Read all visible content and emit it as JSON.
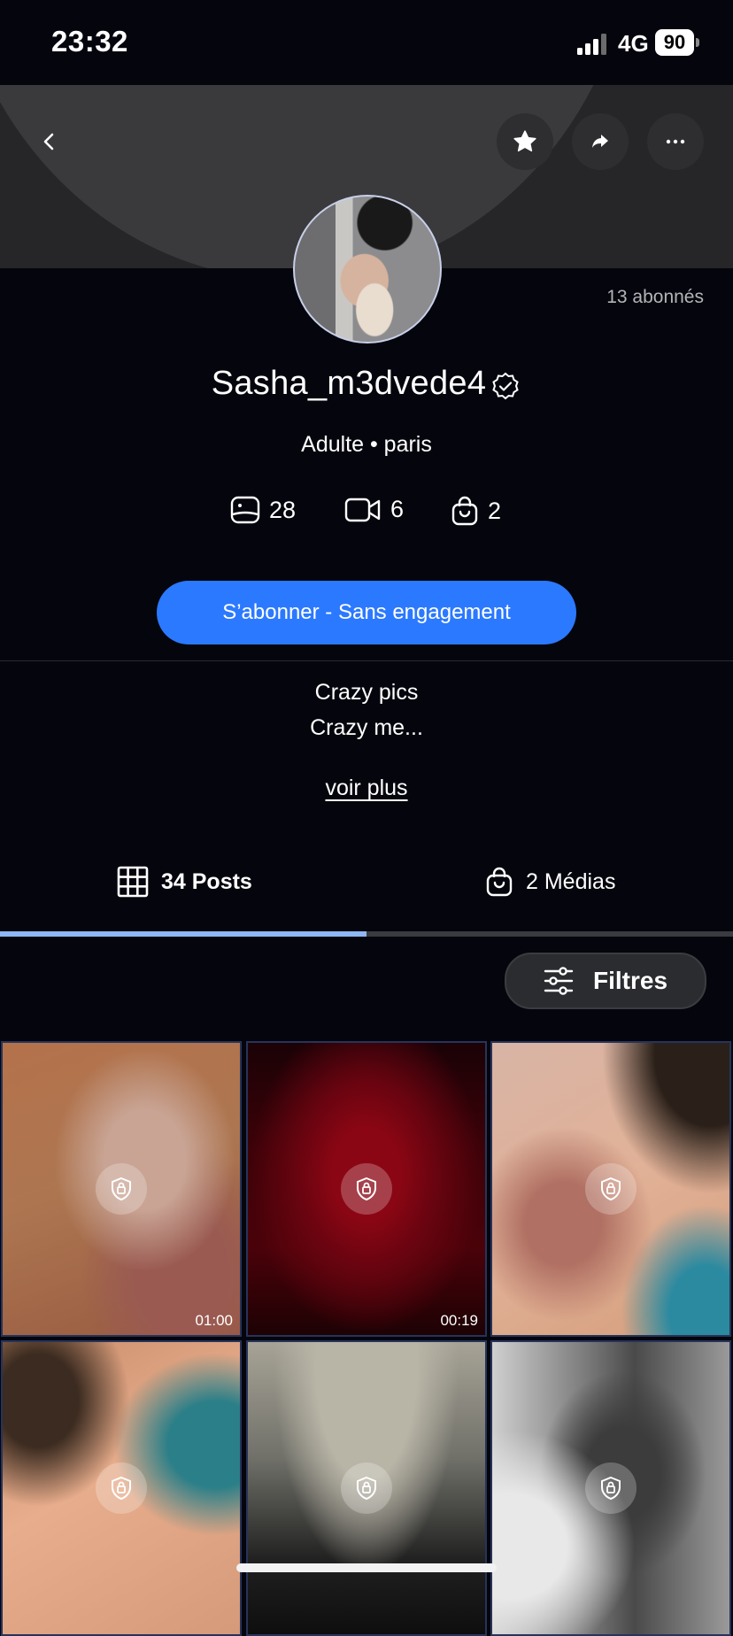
{
  "status_bar": {
    "time": "23:32",
    "network": "4G",
    "battery": "90"
  },
  "profile": {
    "followers": "13 abonnés",
    "username": "Sasha_m3dvede4",
    "meta": "Adulte • paris",
    "stats": {
      "photos": "28",
      "videos": "6",
      "medias": "2"
    },
    "subscribe_label": "S’abonner - Sans engagement",
    "bio_line1": "Crazy pics",
    "bio_line2": "Crazy me...",
    "see_more": "voir plus"
  },
  "tabs": {
    "posts": "34 Posts",
    "medias": "2 Médias",
    "active": "posts"
  },
  "filter_label": "Filtres",
  "grid": {
    "tiles": [
      {
        "duration": "01:00",
        "locked": true
      },
      {
        "duration": "00:19",
        "locked": true
      },
      {
        "duration": "",
        "locked": true
      },
      {
        "duration": "",
        "locked": true
      },
      {
        "duration": "",
        "locked": true
      },
      {
        "duration": "",
        "locked": true
      }
    ]
  },
  "colors": {
    "background": "#05060d",
    "accent": "#2b79ff",
    "tab_indicator": "#8fb6f5"
  },
  "icons": [
    "back-icon",
    "star-icon",
    "share-icon",
    "more-icon",
    "verified-icon",
    "photo-icon",
    "video-icon",
    "bag-icon",
    "grid-icon",
    "filter-icon",
    "lock-icon"
  ]
}
